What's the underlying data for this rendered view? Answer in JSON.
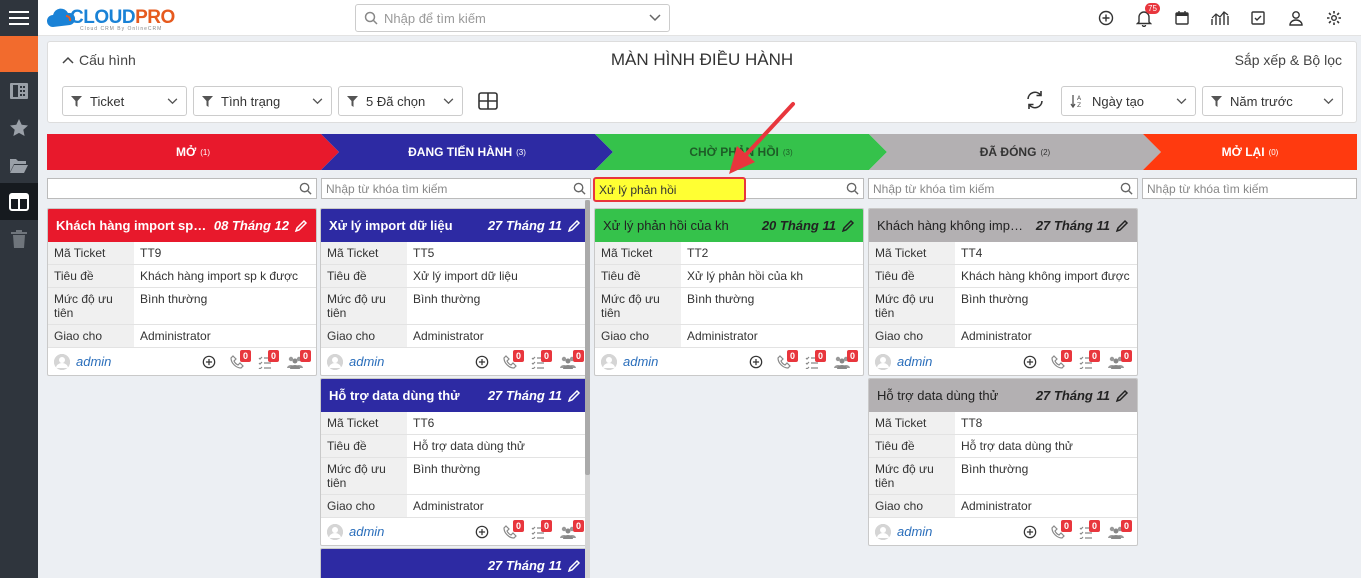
{
  "app": {
    "logo_text_1": "CLOUD",
    "logo_text_2": "PRO",
    "logo_sub": "Cloud CRM By OnlineCRM"
  },
  "topbar": {
    "search_placeholder": "Nhập để tìm kiếm",
    "notification_count": "75"
  },
  "panel": {
    "config_label": "Cấu hình",
    "title": "MÀN HÌNH ĐIỀU HÀNH",
    "sort_filter_label": "Sắp xếp & Bộ lọc"
  },
  "filters": {
    "module": "Ticket",
    "status": "Tình trạng",
    "selected": "5 Đã chọn",
    "sort_by": "Ngày tạo",
    "period": "Năm trước"
  },
  "stages": [
    {
      "label": "Mở",
      "count": "(1)",
      "color": "#e8192c"
    },
    {
      "label": "Đang tiến hành",
      "count": "(3)",
      "color": "#2d2aa3"
    },
    {
      "label": "Chờ phản hồi",
      "count": "(3)",
      "color": "#35c24b"
    },
    {
      "label": "Đã đóng",
      "count": "(2)",
      "color": "#b3b0b2"
    },
    {
      "label": "Mở lại",
      "count": "(0)",
      "color": "#ff3a0f"
    }
  ],
  "column_search": {
    "placeholder": "Nhập từ khóa tìm kiếm",
    "active_value": "Xử lý phản hồi"
  },
  "field_labels": {
    "code": "Mã Ticket",
    "subject": "Tiêu đề",
    "priority": "Mức độ ưu tiên",
    "assigned": "Giao cho"
  },
  "cards": [
    {
      "title": "Khách hàng import sp k được",
      "date": "08 Tháng 12",
      "code": "TT9",
      "subject": "Khách hàng import sp k được",
      "priority": "Bình thường",
      "assigned": "Administrator",
      "user": "admin",
      "calls": "0",
      "tasks": "0",
      "meetings": "0"
    },
    {
      "title": "Xử lý import dữ liệu",
      "date": "27 Tháng 11",
      "code": "TT5",
      "subject": "Xử lý import dữ liệu",
      "priority": "Bình thường",
      "assigned": "Administrator",
      "user": "admin",
      "calls": "0",
      "tasks": "0",
      "meetings": "0"
    },
    {
      "title": "Hỗ trợ data dùng thử",
      "date": "27 Tháng 11",
      "code": "TT6",
      "subject": "Hỗ trợ data dùng thử",
      "priority": "Bình thường",
      "assigned": "Administrator",
      "user": "admin",
      "calls": "0",
      "tasks": "0",
      "meetings": "0"
    },
    {
      "title": "",
      "date": "27 Tháng 11"
    },
    {
      "title": "Xử lý phản hồi của kh",
      "date": "20 Tháng 11",
      "code": "TT2",
      "subject": "Xử lý phản hồi của kh",
      "priority": "Bình thường",
      "assigned": "Administrator",
      "user": "admin",
      "calls": "0",
      "tasks": "0",
      "meetings": "0"
    },
    {
      "title": "Khách hàng không import được",
      "date": "27 Tháng 11",
      "code": "TT4",
      "subject": "Khách hàng không import được",
      "priority": "Bình thường",
      "assigned": "Administrator",
      "user": "admin",
      "calls": "0",
      "tasks": "0",
      "meetings": "0"
    },
    {
      "title": "Hỗ trợ data dùng thử",
      "date": "27 Tháng 11",
      "code": "TT8",
      "subject": "Hỗ trợ data dùng thử",
      "priority": "Bình thường",
      "assigned": "Administrator",
      "user": "admin",
      "calls": "0",
      "tasks": "0",
      "meetings": "0"
    }
  ]
}
